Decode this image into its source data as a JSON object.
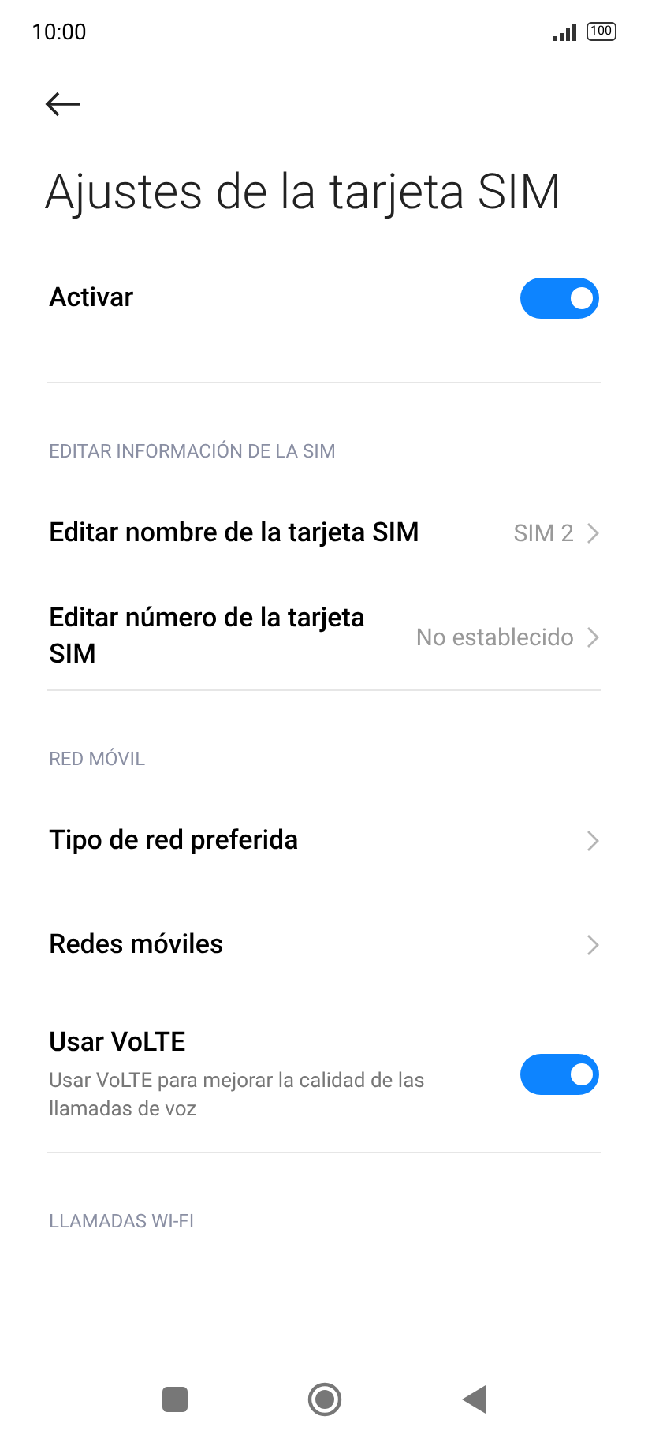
{
  "status_bar": {
    "time": "10:00",
    "battery": "100"
  },
  "title": "Ajustes de la tarjeta SIM",
  "sections": [
    {
      "rows": [
        {
          "kind": "toggle",
          "label": "Activar",
          "on": true
        }
      ]
    },
    {
      "header": "EDITAR INFORMACIÓN DE LA SIM",
      "rows": [
        {
          "kind": "link",
          "label": "Editar nombre de la tarjeta SIM",
          "value": "SIM 2"
        },
        {
          "kind": "link",
          "label": "Editar número de la tarjeta SIM",
          "value": "No establecido"
        }
      ]
    },
    {
      "header": "RED MÓVIL",
      "rows": [
        {
          "kind": "link",
          "label": "Tipo de red preferida"
        },
        {
          "kind": "link",
          "label": "Redes móviles"
        },
        {
          "kind": "toggle",
          "label": "Usar VoLTE",
          "description": "Usar VoLTE para mejorar la calidad de las llamadas de voz",
          "on": true
        }
      ]
    },
    {
      "header": "LLAMADAS WI-FI"
    }
  ]
}
